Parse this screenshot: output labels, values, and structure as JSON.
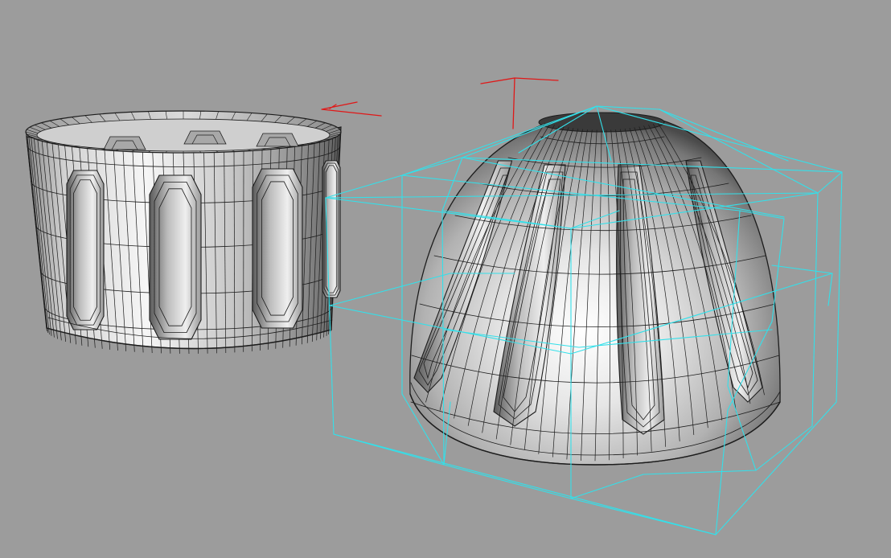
{
  "viewport": {
    "background": "#9c9c9c"
  },
  "colors": {
    "surface_light": "#f4f4f4",
    "surface_mid": "#c4c4c4",
    "surface_dark": "#6a6a6a",
    "surface_deep": "#3a3a3a",
    "mesh_wire": "#1c1c1c",
    "cage_wire": "#33e0ea",
    "gizmo": "#e01818"
  },
  "objects": [
    {
      "name": "cylinder-body",
      "kind": "subdivision-mesh",
      "selected": false
    },
    {
      "name": "dome-body",
      "kind": "subdivision-mesh",
      "selected": true
    }
  ],
  "icons": {
    "gizmo_cylinder": "transform-gizmo-icon",
    "gizmo_dome": "transform-gizmo-icon"
  }
}
